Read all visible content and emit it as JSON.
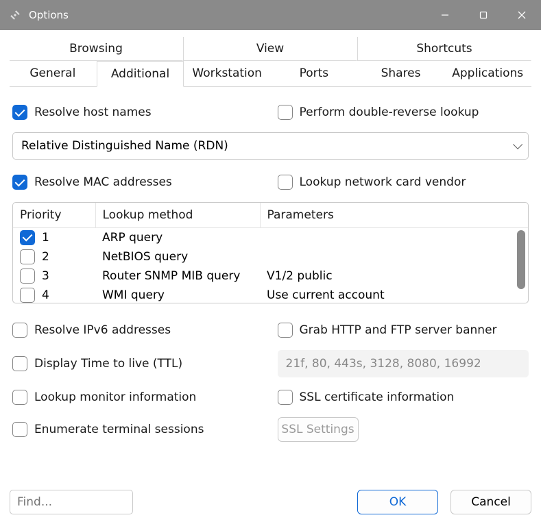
{
  "window": {
    "title": "Options"
  },
  "tabs": {
    "row1": [
      "Browsing",
      "View",
      "Shortcuts"
    ],
    "row2": [
      "General",
      "Additional",
      "Workstation",
      "Ports",
      "Shares",
      "Applications"
    ],
    "active": "Additional"
  },
  "options": {
    "resolve_host_names": {
      "label": "Resolve host names",
      "checked": true
    },
    "double_reverse": {
      "label": "Perform double-reverse lookup",
      "checked": false
    },
    "distinguished_name_mode": "Relative Distinguished Name (RDN)",
    "resolve_mac": {
      "label": "Resolve MAC addresses",
      "checked": true
    },
    "lookup_vendor": {
      "label": "Lookup network card vendor",
      "checked": false
    },
    "resolve_ipv6": {
      "label": "Resolve IPv6 addresses",
      "checked": false
    },
    "grab_banner": {
      "label": "Grab HTTP and FTP server banner",
      "checked": false
    },
    "display_ttl": {
      "label": "Display Time to live (TTL)",
      "checked": false
    },
    "banner_ports": "21f, 80, 443s, 3128, 8080, 16992",
    "lookup_monitor": {
      "label": "Lookup monitor information",
      "checked": false
    },
    "ssl_cert_info": {
      "label": "SSL certificate information",
      "checked": false
    },
    "enumerate_terminal": {
      "label": "Enumerate terminal sessions",
      "checked": false
    },
    "ssl_settings_btn": "SSL Settings"
  },
  "mac_table": {
    "columns": [
      "Priority",
      "Lookup method",
      "Parameters"
    ],
    "rows": [
      {
        "checked": true,
        "priority": "1",
        "method": "ARP query",
        "params": ""
      },
      {
        "checked": false,
        "priority": "2",
        "method": "NetBIOS query",
        "params": ""
      },
      {
        "checked": false,
        "priority": "3",
        "method": "Router SNMP MIB query",
        "params": "V1/2 public"
      },
      {
        "checked": false,
        "priority": "4",
        "method": "WMI query",
        "params": "Use current account"
      }
    ]
  },
  "footer": {
    "find_placeholder": "Find...",
    "ok": "OK",
    "cancel": "Cancel"
  }
}
